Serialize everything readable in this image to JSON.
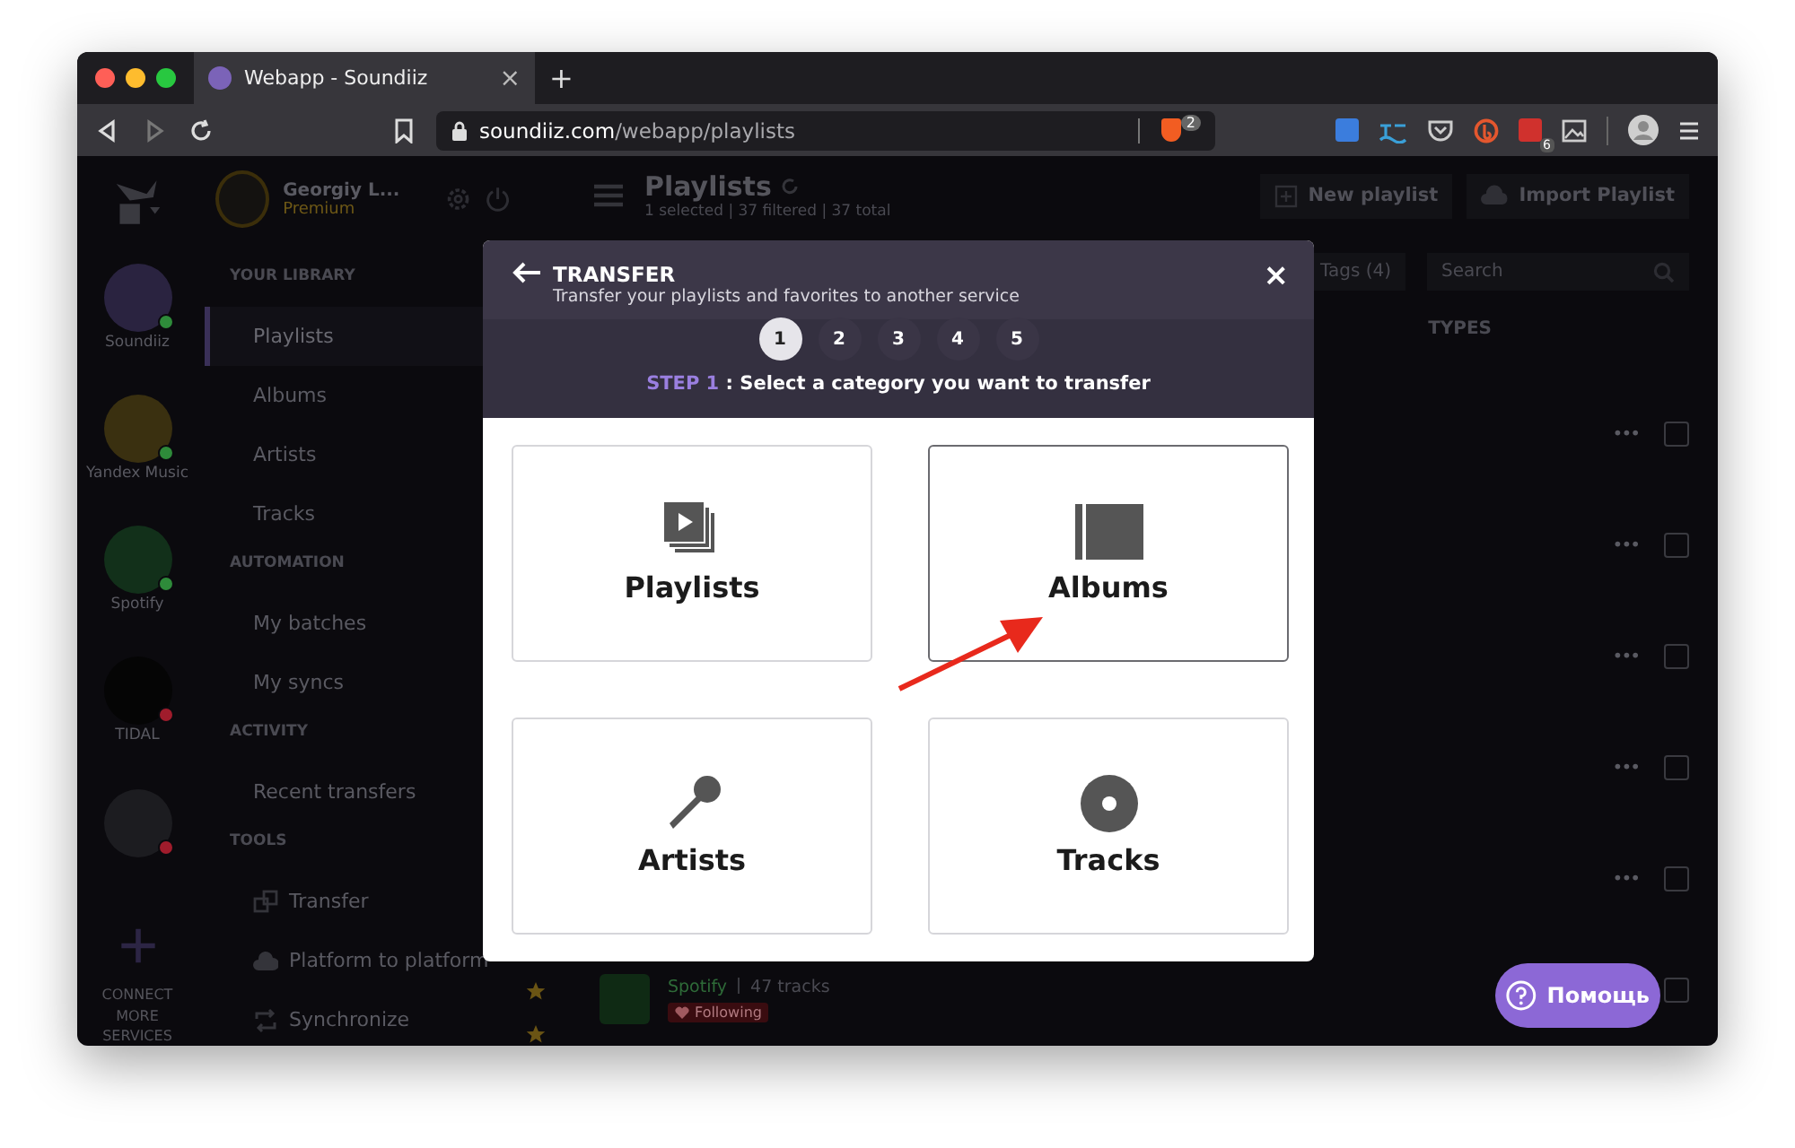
{
  "browser": {
    "tab_title": "Webapp - Soundiiz",
    "tab_close": "×",
    "new_tab": "+",
    "url_host": "soundiiz.com",
    "url_path": "/webapp/playlists",
    "shield_badge": "2",
    "extension_badge": "6"
  },
  "user": {
    "name": "Georgiy L...",
    "plan": "Premium"
  },
  "services": [
    {
      "name": "Soundiiz",
      "kind": "soundiiz",
      "color": "#2e8b3a"
    },
    {
      "name": "Yandex Music",
      "kind": "yandex",
      "color": "#2e8b3a"
    },
    {
      "name": "Spotify",
      "kind": "spotify",
      "color": "#2e8b3a"
    },
    {
      "name": "TIDAL",
      "kind": "tidal",
      "color": "#a01c2c"
    },
    {
      "kind": "deezer",
      "color": "#a01c2c"
    }
  ],
  "connect": "CONNECT MORE SERVICES",
  "sidebar": [
    {
      "heading": "YOUR LIBRARY",
      "items": [
        {
          "label": "Playlists",
          "kind": "plain",
          "selected": true
        },
        {
          "label": "Albums",
          "kind": "plain",
          "selected": false
        },
        {
          "label": "Artists",
          "kind": "plain",
          "selected": false
        },
        {
          "label": "Tracks",
          "kind": "plain",
          "selected": false
        }
      ]
    },
    {
      "heading": "AUTOMATION",
      "items": [
        {
          "label": "My batches",
          "kind": "plain",
          "selected": false
        },
        {
          "label": "My syncs",
          "kind": "plain",
          "selected": false
        }
      ]
    },
    {
      "heading": "ACTIVITY",
      "items": [
        {
          "label": "Recent transfers",
          "kind": "plain",
          "selected": false
        }
      ]
    },
    {
      "heading": "TOOLS",
      "items": [
        {
          "label": "Transfer",
          "kind": "transfer",
          "selected": false
        },
        {
          "label": "Platform to platform",
          "kind": "platform",
          "selected": false
        },
        {
          "label": "Synchronize",
          "kind": "sync",
          "selected": false
        }
      ]
    }
  ],
  "main": {
    "title": "Playlists",
    "counts": "1 selected | 37 filtered | 37 total",
    "new_playlist": "New playlist",
    "import_playlist": "Import Playlist",
    "tags": "Tags (4)",
    "search_placeholder": "Search",
    "types_heading": "TYPES",
    "rows": [
      {
        "more": "•••",
        "checked": false,
        "favorite": false
      },
      {
        "more": "•••",
        "checked": false,
        "favorite": false
      },
      {
        "more": "•••",
        "checked": false,
        "favorite": false
      },
      {
        "more": "•••",
        "checked": false,
        "favorite": false
      },
      {
        "more": "•••",
        "checked": false,
        "favorite": false
      },
      {
        "checked": false,
        "favorite": true
      }
    ],
    "last_item": {
      "service": "Spotify",
      "tracks": "47 tracks",
      "tag": "Following",
      "favorite": true
    }
  },
  "modal": {
    "title": "TRANSFER",
    "subtitle": "Transfer your playlists and favorites to another service",
    "close": "×",
    "steps": [
      {
        "label": "1",
        "selected": true
      },
      {
        "label": "2",
        "selected": false
      },
      {
        "label": "3",
        "selected": false
      },
      {
        "label": "4",
        "selected": false
      },
      {
        "label": "5",
        "selected": false
      }
    ],
    "step_label": "STEP 1",
    "step_text": ": Select a category you want to transfer",
    "categories": [
      {
        "label": "Playlists",
        "kind": "playlist",
        "highlighted": false
      },
      {
        "label": "Albums",
        "kind": "album",
        "highlighted": true
      },
      {
        "label": "Artists",
        "kind": "artist",
        "highlighted": false
      },
      {
        "label": "Tracks",
        "kind": "track",
        "highlighted": false
      }
    ]
  },
  "help": {
    "label": "Помощь"
  }
}
